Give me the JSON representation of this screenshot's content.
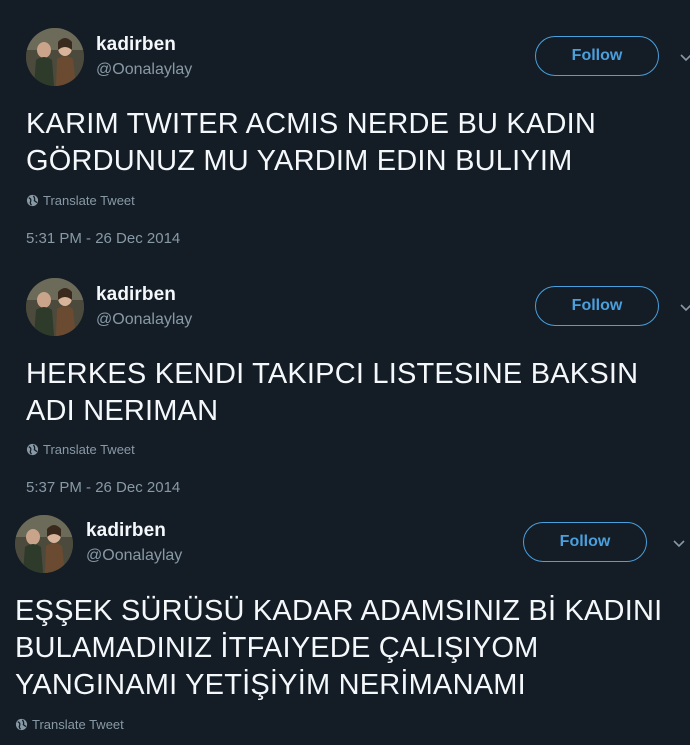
{
  "tweets": [
    {
      "username": "kadirben",
      "handle": "@Oonalaylay",
      "follow_label": "Follow",
      "text": "KARIM TWITER ACMIS NERDE BU KADIN\nGÖRDUNUZ MU YARDIM EDIN BULIYIM",
      "translate_label": "Translate Tweet",
      "timestamp": "5:31 PM - 26 Dec 2014"
    },
    {
      "username": "kadirben",
      "handle": "@Oonalaylay",
      "follow_label": "Follow",
      "text": "HERKES KENDI TAKIPCI LISTESINE BAKSIN\nADI NERIMAN",
      "translate_label": "Translate Tweet",
      "timestamp": "5:37 PM - 26 Dec 2014"
    },
    {
      "username": "kadirben",
      "handle": "@Oonalaylay",
      "follow_label": "Follow",
      "text": "EŞŞEK SÜRÜSÜ KADAR ADAMSINIZ Bİ KADINI\nBULAMADINIZ İTFAIYEDE ÇALIŞIYOM\nYANGINAMI YETİŞİYİM NERİMANAMI",
      "translate_label": "Translate Tweet"
    }
  ],
  "colors": {
    "background": "#141d26",
    "accent": "#4a9fdc",
    "secondary_text": "#8899a6",
    "primary_text": "#f5f8fa"
  }
}
